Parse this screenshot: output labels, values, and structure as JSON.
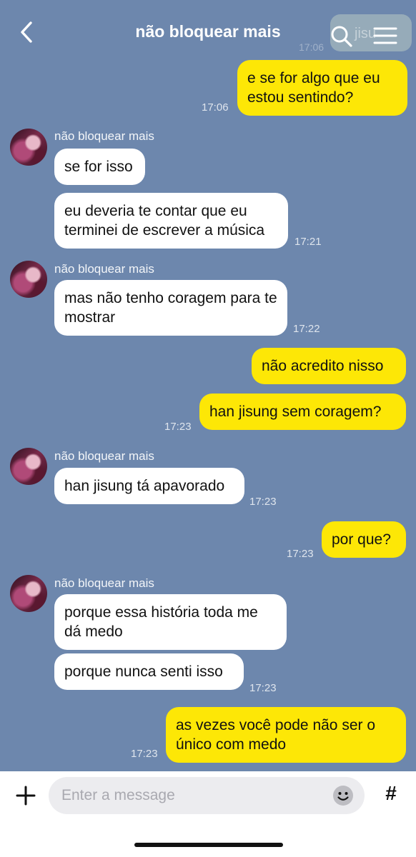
{
  "header": {
    "title": "não bloquear mais",
    "ghost_text": "jisu",
    "ghost_time": "17:06"
  },
  "messages": [
    {
      "text": "e se for algo que eu estou sentindo?",
      "time": "17:06"
    },
    {
      "sender": "não bloquear mais",
      "text": "se for isso"
    },
    {
      "text": "eu deveria te contar que eu terminei de escrever a música",
      "time": "17:21"
    },
    {
      "sender": "não bloquear mais",
      "text": "mas não tenho coragem para te mostrar",
      "time": "17:22"
    },
    {
      "text": "não acredito nisso"
    },
    {
      "text": "han jisung sem coragem?",
      "time": "17:23"
    },
    {
      "sender": "não bloquear mais",
      "text": "han jisung tá apavorado",
      "time": "17:23"
    },
    {
      "text": "por que?",
      "time": "17:23"
    },
    {
      "sender": "não bloquear mais",
      "text": "porque essa história toda me dá medo"
    },
    {
      "text": "porque nunca senti isso",
      "time": "17:23"
    },
    {
      "text": "as vezes você pode não ser o único com medo",
      "time": "17:23"
    }
  ],
  "composer": {
    "placeholder": "Enter a message",
    "hash_label": "#"
  },
  "icons": [
    "back-chevron-icon",
    "search-icon",
    "menu-icon",
    "plus-icon",
    "emoji-icon",
    "hash-icon"
  ],
  "colors": {
    "background": "#6d87ad",
    "outgoing_bubble": "#fde706",
    "incoming_bubble": "#ffffff"
  }
}
